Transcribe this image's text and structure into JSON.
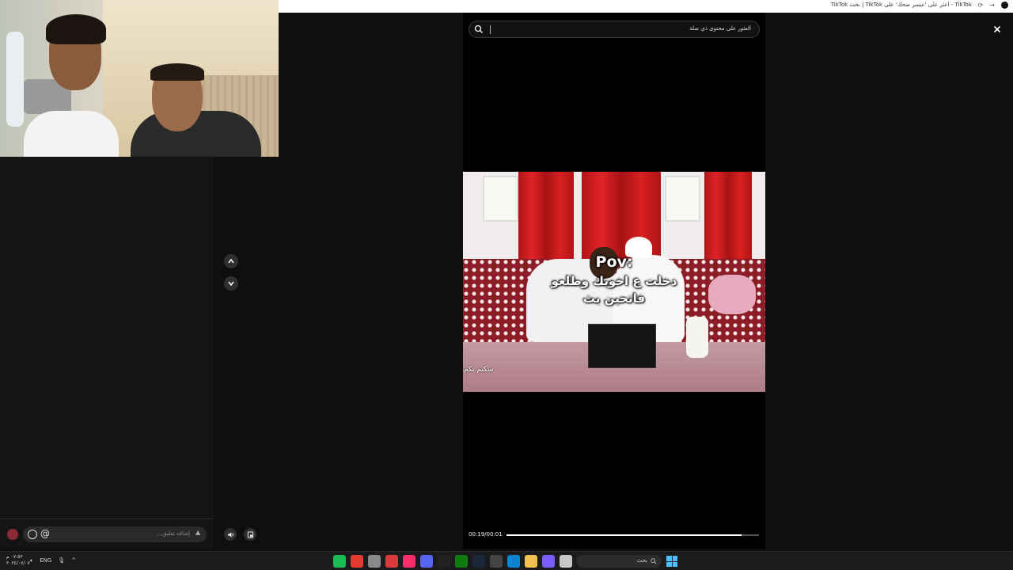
{
  "browser": {
    "tab_title": "TikTok - اعثر على 'عيسر ضحك' على TikTok | بحث TikTok"
  },
  "search": {
    "query": "العثور على محتوى ذي صلة"
  },
  "video": {
    "caption_line1": "Pov:",
    "caption_line2": "دخلت ع اخويك وطلعو",
    "caption_line3": "فاتحين بث",
    "watermark": "سكتم بكم",
    "timecode": "00:19/00:01",
    "progress": 0.93
  },
  "comment": {
    "placeholder": "إضافة تعليق...",
    "at_symbol": "@"
  },
  "taskbar": {
    "time": "٠٧:٥٣ م",
    "date": "٢٠٢٤/٠٧/٠٧",
    "language": "ENG",
    "search_label": "بحث",
    "app_icons": [
      "spotify-icon",
      "chrome-red-icon",
      "settings-icon",
      "gallery-icon",
      "tiktok-pink-icon",
      "discord-icon",
      "tiktok-icon",
      "xbox-icon",
      "steam-icon",
      "store-icon",
      "edge-icon",
      "folder-icon",
      "copilot-icon",
      "explorer-icon"
    ]
  },
  "colors": {
    "accent_progress": "#ffffff",
    "background": "#0f0f0f",
    "taskbar": "#1b1b1d",
    "windows_blue": "#4cc2ff"
  }
}
